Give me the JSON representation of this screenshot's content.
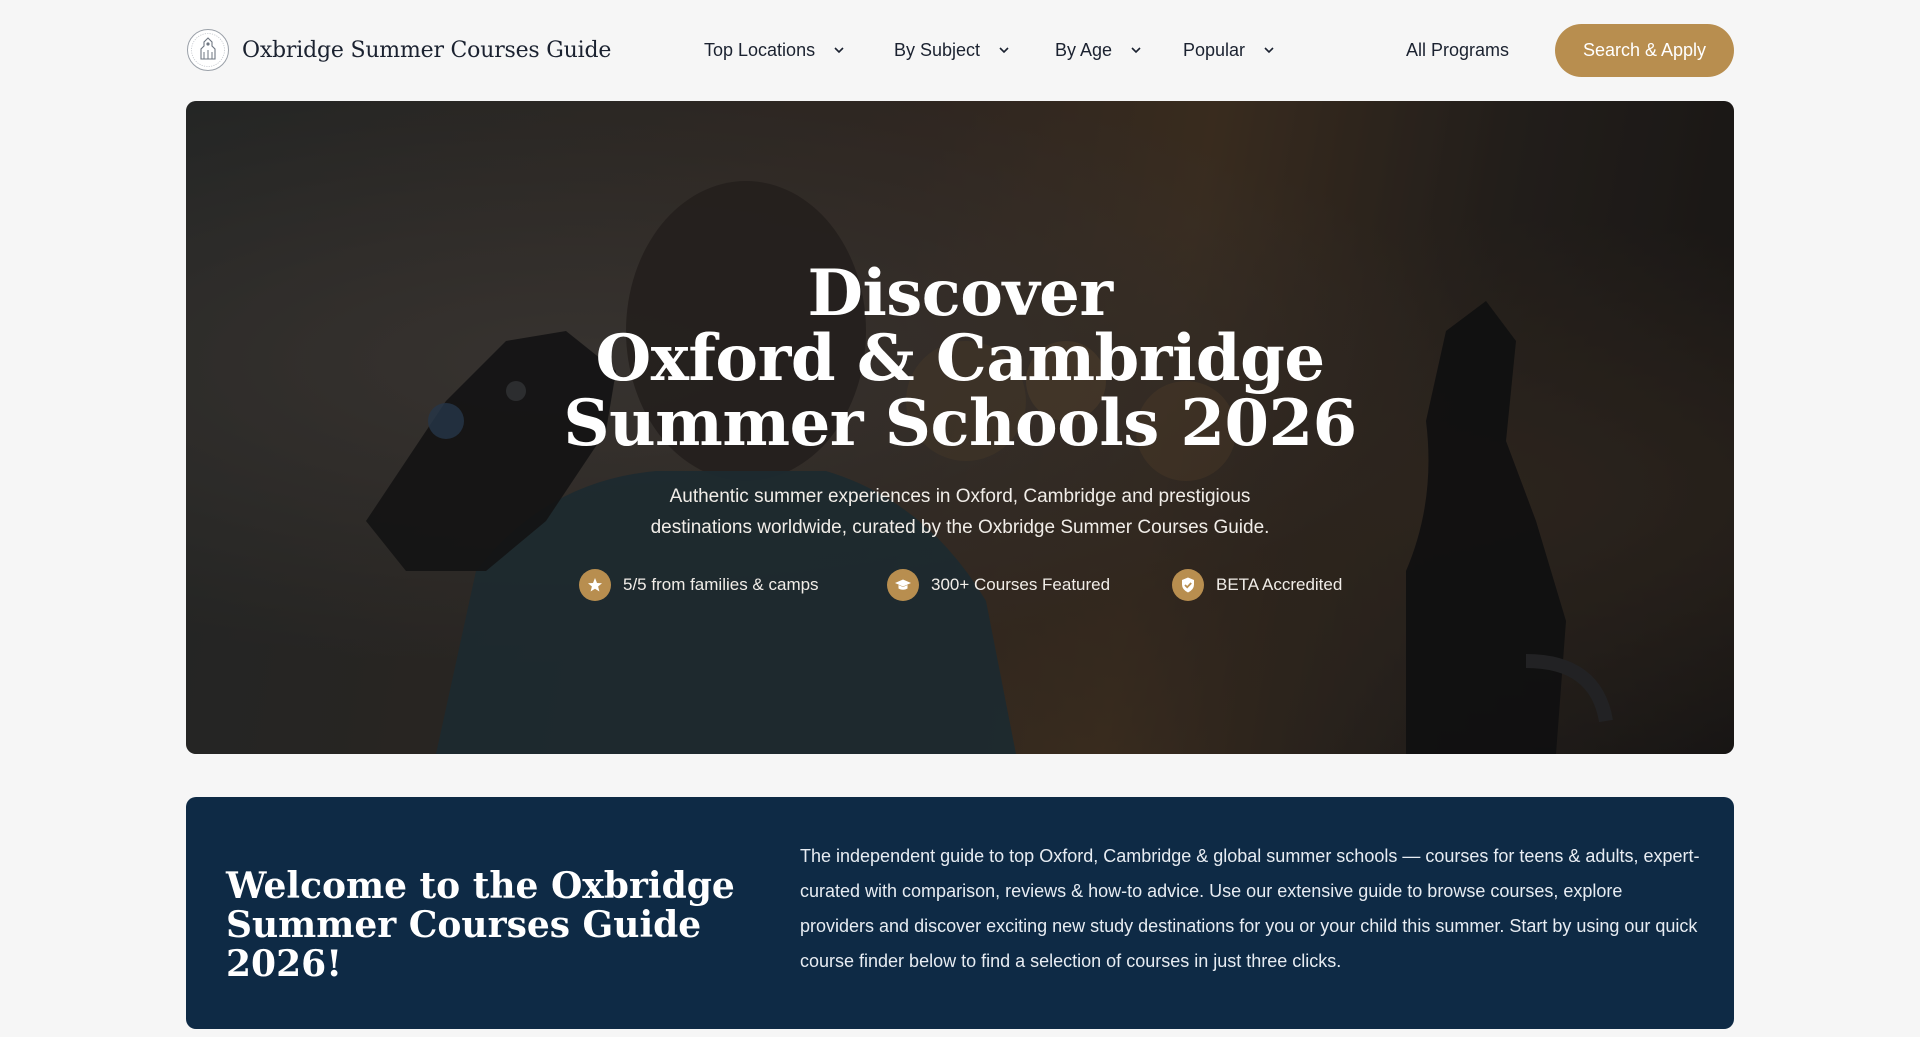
{
  "header": {
    "brand_name": "Oxbridge Summer Courses Guide",
    "brand_icon": "crest-icon",
    "nav": [
      {
        "label": "Top Locations"
      },
      {
        "label": "By Subject"
      },
      {
        "label": "By Age"
      },
      {
        "label": "Popular"
      }
    ],
    "all_programs": "All Programs",
    "cta": "Search & Apply"
  },
  "hero": {
    "title_lines": [
      "Discover",
      "Oxford & Cambridge",
      "Summer Schools 2026"
    ],
    "subtitle_lines": [
      "Authentic summer experiences in Oxford, Cambridge and prestigious",
      "destinations worldwide, curated by the Oxbridge Summer Courses Guide."
    ],
    "badges": [
      {
        "icon": "star-icon",
        "label": "5/5 from families & camps"
      },
      {
        "icon": "graduation-cap-icon",
        "label": "300+ Courses Featured"
      },
      {
        "icon": "shield-check-icon",
        "label": "BETA Accredited"
      }
    ]
  },
  "welcome": {
    "title_lines": [
      "Welcome to the Oxbridge",
      "Summer Courses Guide 2026!"
    ],
    "text": "The independent guide to top Oxford, Cambridge & global summer schools — courses for teens & adults, expert-curated with comparison, reviews & how-to advice. Use our extensive guide to browse courses, explore providers and discover exciting new study destinations for you or your child this summer. Start by using our quick course finder below to find a selection of courses in just three clicks."
  },
  "colors": {
    "accent": "#b88e4f",
    "welcome_bg": "#0e2a45",
    "page_bg": "#f6f6f6",
    "text": "#1b2230"
  }
}
